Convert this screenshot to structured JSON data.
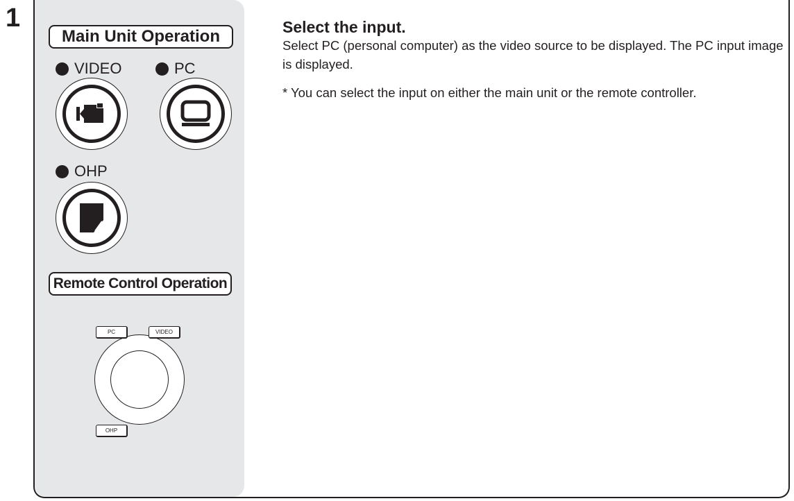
{
  "step": {
    "number": "1"
  },
  "main_unit": {
    "label": "Main Unit Operation",
    "buttons": [
      {
        "indicator": "VIDEO",
        "icon": "video-camera-icon"
      },
      {
        "indicator": "PC",
        "icon": "monitor-icon"
      },
      {
        "indicator": "OHP",
        "icon": "ohp-document-icon"
      }
    ]
  },
  "remote": {
    "label": "Remote Control Operation",
    "keys": [
      "PC",
      "VIDEO",
      "OHP"
    ]
  },
  "instructions": {
    "heading": "Select the input.",
    "body": "Select PC (personal computer) as the video source to be displayed. The PC input image is displayed.",
    "note": "* You can select the input on either the main unit or the remote controller."
  },
  "colors": {
    "ink": "#231f20",
    "panel": "#e6e7e8"
  }
}
